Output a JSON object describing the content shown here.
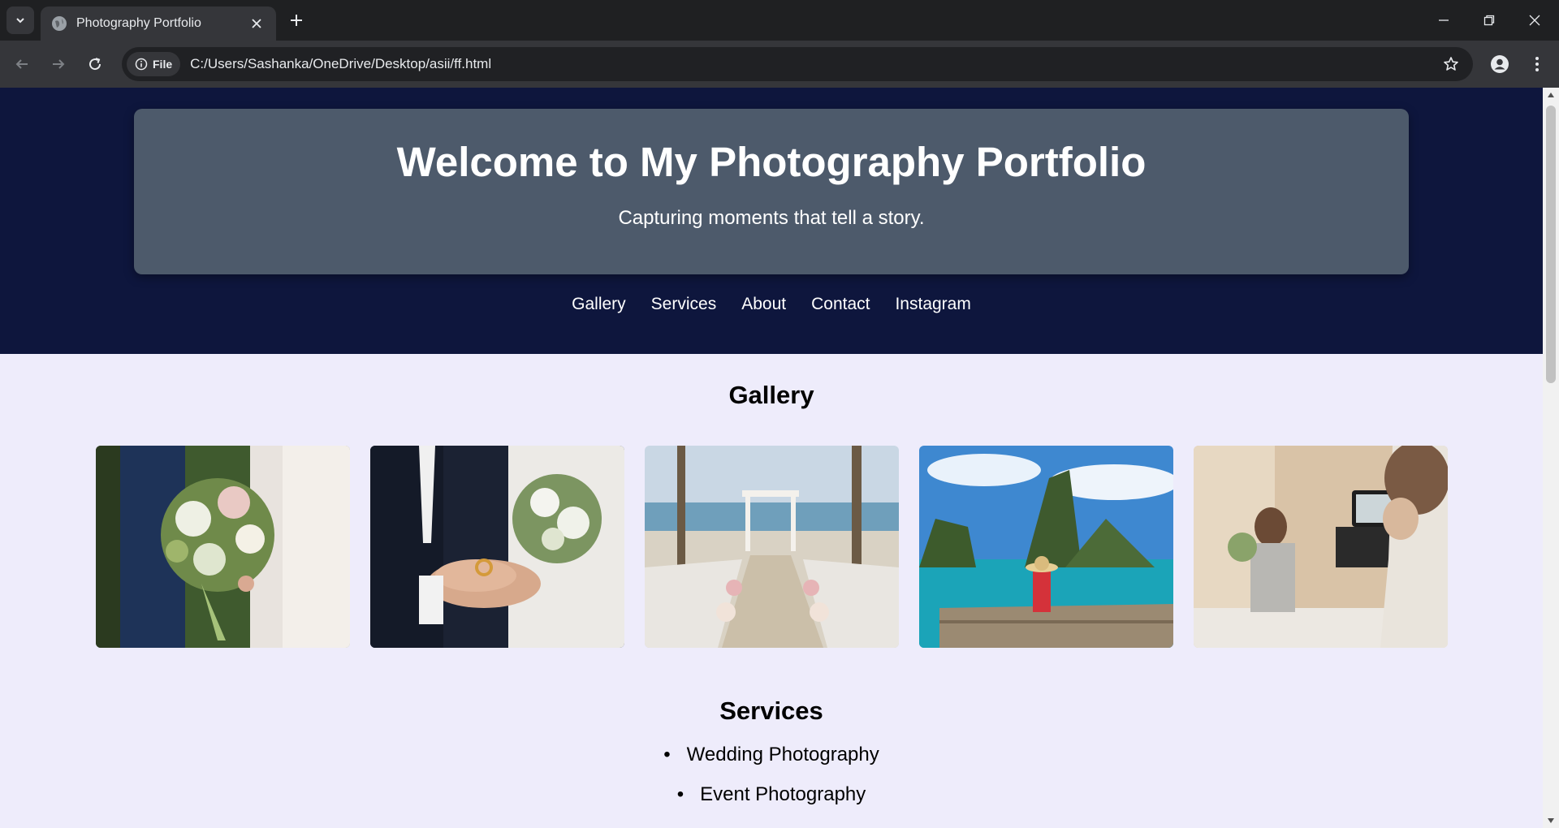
{
  "browser": {
    "tab_title": "Photography Portfolio",
    "site_chip": "File",
    "url": "C:/Users/Sashanka/OneDrive/Desktop/asii/ff.html"
  },
  "header": {
    "title": "Welcome to My Photography Portfolio",
    "tagline": "Capturing moments that tell a story."
  },
  "nav": {
    "items": [
      "Gallery",
      "Services",
      "About",
      "Contact",
      "Instagram"
    ]
  },
  "gallery": {
    "title": "Gallery",
    "photos": [
      {
        "subject": "bridal bouquet with couple"
      },
      {
        "subject": "wedding rings in groom's hands"
      },
      {
        "subject": "beach wedding aisle with chairs and flowers"
      },
      {
        "subject": "traveler in hat on dock facing tropical islands"
      },
      {
        "subject": "photographer filming florist with camera rig"
      }
    ]
  },
  "services": {
    "title": "Services",
    "items": [
      "Wedding Photography",
      "Event Photography"
    ]
  }
}
